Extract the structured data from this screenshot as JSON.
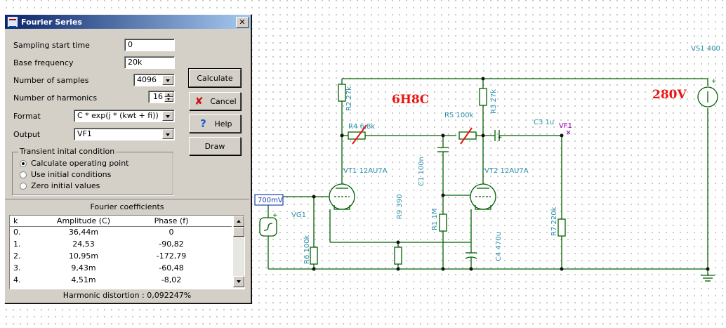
{
  "dialog": {
    "title": "Fourier Series",
    "close": "✕",
    "fields": {
      "sampling_start_time": {
        "label": "Sampling start time",
        "value": "0"
      },
      "base_frequency": {
        "label": "Base frequency",
        "value": "20k"
      },
      "number_of_samples": {
        "label": "Number of samples",
        "value": "4096"
      },
      "number_of_harmonics": {
        "label": "Number of harmonics",
        "value": "16"
      },
      "format": {
        "label": "Format",
        "value": "C * exp(j * (kwt + fi))"
      },
      "output": {
        "label": "Output",
        "value": "VF1"
      }
    },
    "buttons": {
      "calculate": "Calculate",
      "cancel": "Cancel",
      "help": "Help",
      "draw": "Draw"
    },
    "transient": {
      "title": "Transient inital condition",
      "options": [
        "Calculate operating point",
        "Use initial conditions",
        "Zero initial values"
      ],
      "selected": 0
    },
    "coefficients": {
      "title": "Fourier coefficients",
      "columns": [
        "k",
        "Amplitude (C)",
        "Phase (f)"
      ],
      "rows": [
        [
          "0.",
          "36,44m",
          "0"
        ],
        [
          "1.",
          "24,53",
          "-90,82"
        ],
        [
          "2.",
          "10,95m",
          "-172,79"
        ],
        [
          "3.",
          "9,43m",
          "-60,48"
        ],
        [
          "4.",
          "4,51m",
          "-8,02"
        ]
      ],
      "harmonic_distortion_label": "Harmonic distortion :",
      "harmonic_distortion_value": "0,092247%"
    }
  },
  "schematic": {
    "title": "6H8C",
    "supply_label": "280V",
    "vs1": "VS1 400",
    "source_box": "700mV",
    "labels": {
      "r2": "R2 27k",
      "r3": "R3 27k",
      "r4": "R4 6,8k",
      "r5": "R5 100k",
      "c3": "C3 1u",
      "vf1": "VF1",
      "vt1": "VT1 12AU7A",
      "vt2": "VT2 12AU7A",
      "c1": "C1 100n",
      "vg1": "VG1",
      "r9": "R9 390",
      "r1": "R1 1M",
      "r6": "R6 100k",
      "r7": "R7 220k",
      "c4": "C4 470u"
    },
    "colors": {
      "wire": "#006000",
      "label": "#2a8fa8",
      "red": "#ee1111",
      "probe": "#9900aa"
    }
  }
}
